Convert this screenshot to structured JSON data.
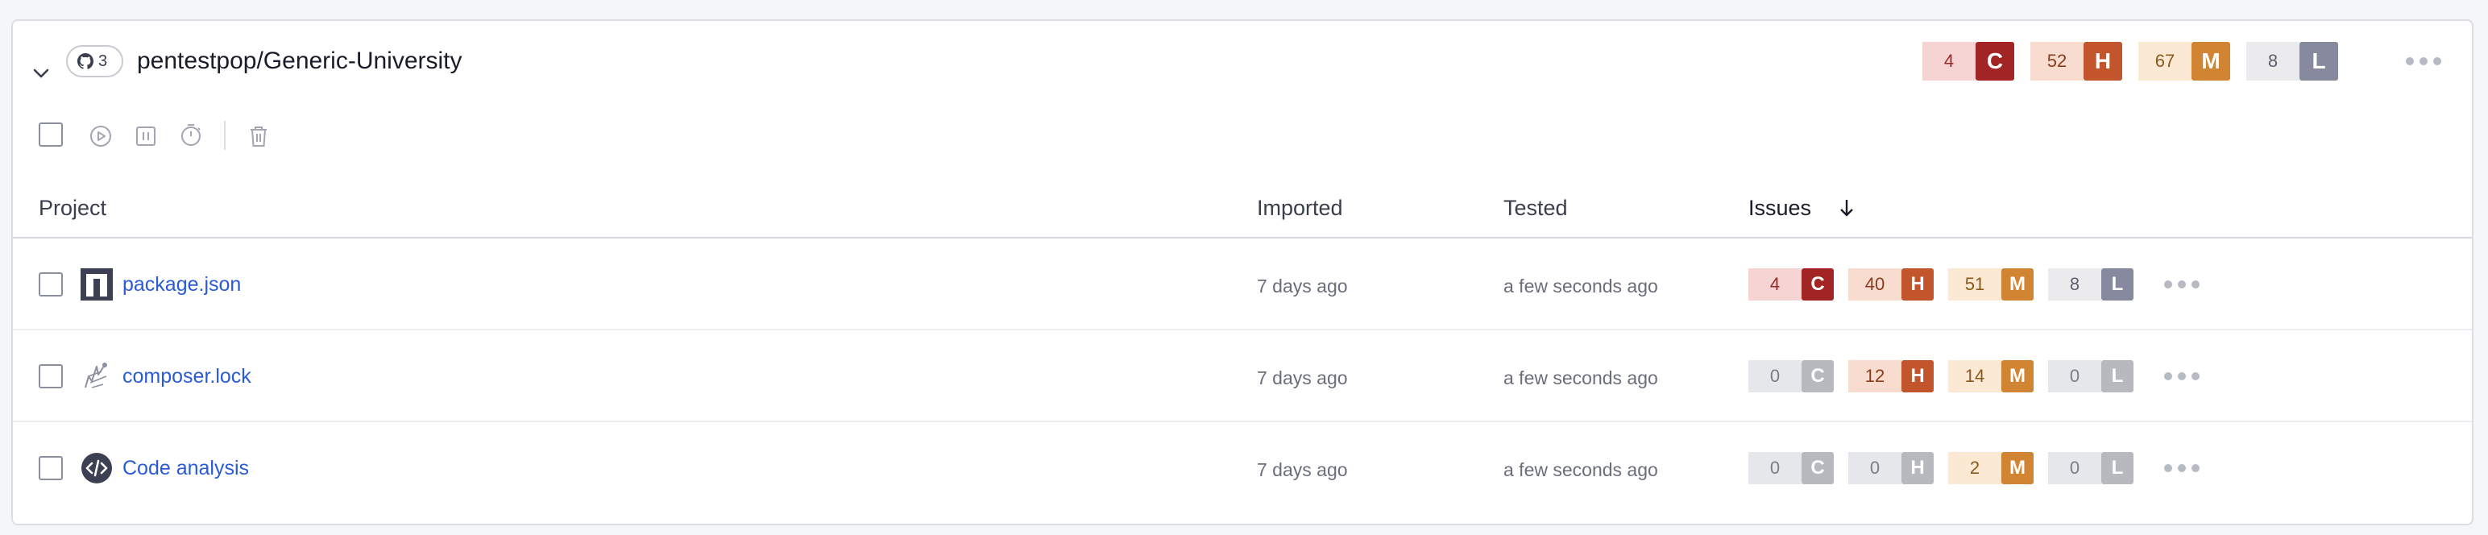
{
  "repo": {
    "name": "pentestpop/Generic-University",
    "project_count": "3",
    "issues": [
      {
        "count": "4",
        "letter": "C",
        "num_bg": "#f6d4d4",
        "num_color": "#9a2a2a",
        "letter_bg": "#a32424"
      },
      {
        "count": "52",
        "letter": "H",
        "num_bg": "#f8dccf",
        "num_color": "#8a3d1c",
        "letter_bg": "#c2552b"
      },
      {
        "count": "67",
        "letter": "M",
        "num_bg": "#fbe9d3",
        "num_color": "#8a5a1c",
        "letter_bg": "#d18431"
      },
      {
        "count": "8",
        "letter": "L",
        "num_bg": "#ebebee",
        "num_color": "#5d606c",
        "letter_bg": "#878a9e"
      }
    ]
  },
  "toolbar": {
    "icons": [
      "select-all-checkbox",
      "play-icon",
      "pause-icon",
      "timer-icon",
      "trash-icon"
    ]
  },
  "table": {
    "columns": {
      "project": "Project",
      "imported": "Imported",
      "tested": "Tested",
      "issues": "Issues"
    },
    "sort_icon": "arrow-down-icon",
    "rows": [
      {
        "name": "package.json",
        "icon": "npm-icon",
        "imported": "7 days ago",
        "tested": "a few seconds ago",
        "issues": [
          {
            "count": "4",
            "letter": "C",
            "active": true
          },
          {
            "count": "40",
            "letter": "H",
            "active": true
          },
          {
            "count": "51",
            "letter": "M",
            "active": true
          },
          {
            "count": "8",
            "letter": "L",
            "active": true
          }
        ]
      },
      {
        "name": "composer.lock",
        "icon": "composer-icon",
        "imported": "7 days ago",
        "tested": "a few seconds ago",
        "issues": [
          {
            "count": "0",
            "letter": "C",
            "active": false
          },
          {
            "count": "12",
            "letter": "H",
            "active": true
          },
          {
            "count": "14",
            "letter": "M",
            "active": true
          },
          {
            "count": "0",
            "letter": "L",
            "active": false
          }
        ]
      },
      {
        "name": "Code analysis",
        "icon": "code-icon",
        "imported": "7 days ago",
        "tested": "a few seconds ago",
        "issues": [
          {
            "count": "0",
            "letter": "C",
            "active": false
          },
          {
            "count": "0",
            "letter": "H",
            "active": false
          },
          {
            "count": "2",
            "letter": "M",
            "active": true
          },
          {
            "count": "0",
            "letter": "L",
            "active": false
          }
        ]
      }
    ]
  },
  "colors": {
    "link": "#2a5bd7",
    "inactive_num_bg": "#e6e7ea",
    "inactive_num_color": "#7a7d88",
    "inactive_letter_bg": "#b8b9bf"
  }
}
